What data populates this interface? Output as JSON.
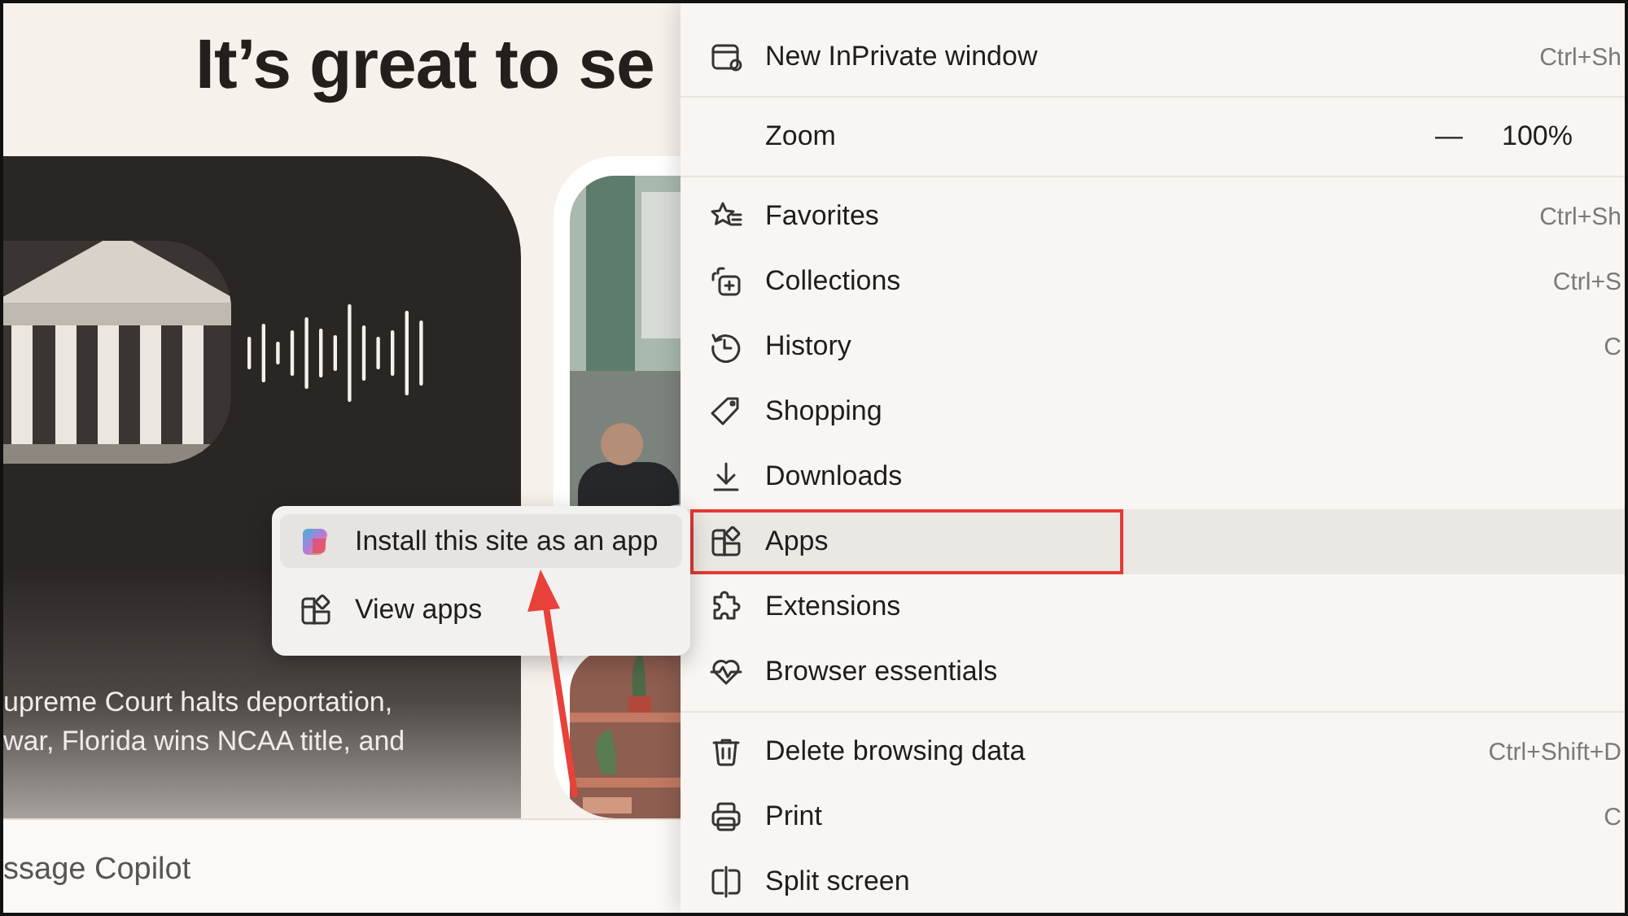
{
  "page": {
    "heading": "It’s great to se",
    "story_lines": [
      "upreme Court halts deportation,",
      "war, Florida wins NCAA title, and"
    ],
    "footer_text": "ssage Copilot"
  },
  "apps_flyout": {
    "items": [
      {
        "label": "Install this site as an app",
        "selected": true
      },
      {
        "label": "View apps",
        "selected": false
      }
    ]
  },
  "menu": {
    "sections": [
      {
        "items": [
          {
            "kind": "item",
            "label": "New InPrivate window",
            "shortcut": "Ctrl+Sh",
            "selected": false,
            "outlined": false
          }
        ]
      },
      {
        "items": [
          {
            "kind": "zoom",
            "label": "Zoom",
            "minus": "—",
            "value": "100%"
          }
        ]
      },
      {
        "items": [
          {
            "kind": "item",
            "label": "Favorites",
            "shortcut": "Ctrl+Sh",
            "selected": false,
            "outlined": false
          },
          {
            "kind": "item",
            "label": "Collections",
            "shortcut": "Ctrl+S",
            "selected": false,
            "outlined": false
          },
          {
            "kind": "item",
            "label": "History",
            "shortcut": "C",
            "selected": false,
            "outlined": false
          },
          {
            "kind": "item",
            "label": "Shopping",
            "selected": false,
            "outlined": false
          },
          {
            "kind": "item",
            "label": "Downloads",
            "selected": false,
            "outlined": false
          },
          {
            "kind": "item",
            "label": "Apps",
            "selected": true,
            "outlined": true
          },
          {
            "kind": "item",
            "label": "Extensions",
            "selected": false,
            "outlined": false
          },
          {
            "kind": "item",
            "label": "Browser essentials",
            "selected": false,
            "outlined": false
          }
        ]
      },
      {
        "items": [
          {
            "kind": "item",
            "label": "Delete browsing data",
            "shortcut": "Ctrl+Shift+D",
            "selected": false,
            "outlined": false
          },
          {
            "kind": "item",
            "label": "Print",
            "shortcut": "C",
            "selected": false,
            "outlined": false
          },
          {
            "kind": "item",
            "label": "Split screen",
            "selected": false,
            "outlined": false
          }
        ]
      }
    ]
  }
}
